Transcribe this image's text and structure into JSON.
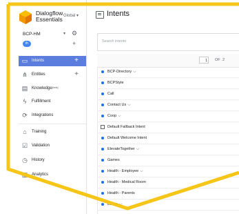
{
  "brand": {
    "line1": "Dialogflow",
    "line2": "Essentials",
    "global": "Global ▾"
  },
  "agent": {
    "name": "BCP-HM",
    "caret": "▾",
    "language": "th"
  },
  "nav": [
    {
      "label": "Intents",
      "icon": "chat-icon",
      "active": true
    },
    {
      "label": "Entities",
      "icon": "entities-icon"
    },
    {
      "label": "Knowledge",
      "badge": "[beta]",
      "icon": "knowledge-icon"
    },
    {
      "label": "Fulfillment",
      "icon": "lightning-icon"
    },
    {
      "label": "Integrations",
      "icon": "integrations-icon"
    },
    {
      "label": "Training",
      "icon": "training-icon"
    },
    {
      "label": "Validation",
      "icon": "validation-icon"
    },
    {
      "label": "History",
      "icon": "history-icon"
    },
    {
      "label": "Analytics",
      "icon": "analytics-icon"
    }
  ],
  "header": {
    "title": "Intents"
  },
  "search": {
    "placeholder": "Search intents"
  },
  "pagination": {
    "current": "1",
    "of": "OF",
    "total": "2"
  },
  "intents": [
    {
      "name": "BCP-Directory",
      "type": "dot",
      "expandable": true
    },
    {
      "name": "BCPStyle",
      "type": "dot"
    },
    {
      "name": "Call",
      "type": "dot"
    },
    {
      "name": "Contact Us",
      "type": "dot",
      "expandable": true
    },
    {
      "name": "Coop",
      "type": "dot",
      "expandable": true
    },
    {
      "name": "Default Fallback Intent",
      "type": "square"
    },
    {
      "name": "Default Welcome Intent",
      "type": "dot"
    },
    {
      "name": "ElevateTogether",
      "type": "dot",
      "expandable": true
    },
    {
      "name": "Games",
      "type": "dot"
    },
    {
      "name": "Health - Employee",
      "type": "dot",
      "expandable": true
    },
    {
      "name": "Health - Medical Room",
      "type": "dot"
    },
    {
      "name": "Health - Parents",
      "type": "dot"
    },
    {
      "name": "Leave",
      "type": "dot",
      "expandable": true
    }
  ],
  "colors": {
    "accent": "#5b7ddd",
    "highlight_border": "#f5c518",
    "dot": "#1a73e8"
  }
}
